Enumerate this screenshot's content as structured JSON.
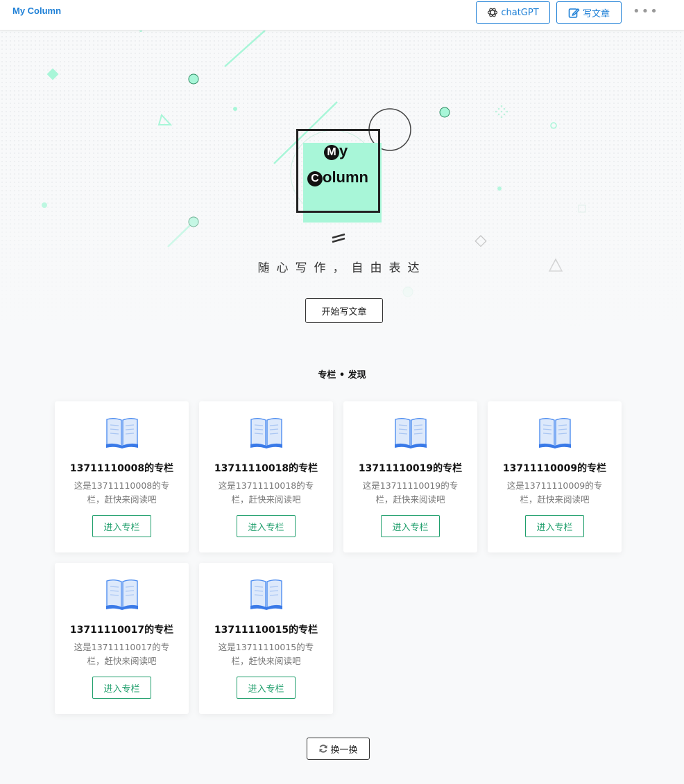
{
  "header": {
    "logo": "My Column",
    "chat_label": "chatGPT",
    "write_label": "写文章",
    "more_label": "•••"
  },
  "hero": {
    "brand_line1": "y",
    "brand_line1_cap": "M",
    "brand_line2": "olumn",
    "brand_line2_cap": "C",
    "slogan": "随心写作，自由表达",
    "start_button": "开始写文章"
  },
  "columns": {
    "title": "专栏 • 发现",
    "items": [
      {
        "title": "13711110008的专栏",
        "desc": "这是13711110008的专栏，赶快来阅读吧",
        "button": "进入专栏"
      },
      {
        "title": "13711110018的专栏",
        "desc": "这是13711110018的专栏，赶快来阅读吧",
        "button": "进入专栏"
      },
      {
        "title": "13711110019的专栏",
        "desc": "这是13711110019的专栏，赶快来阅读吧",
        "button": "进入专栏"
      },
      {
        "title": "13711110009的专栏",
        "desc": "这是13711110009的专栏，赶快来阅读吧",
        "button": "进入专栏"
      },
      {
        "title": "13711110017的专栏",
        "desc": "这是13711110017的专栏，赶快来阅读吧",
        "button": "进入专栏"
      },
      {
        "title": "13711110015的专栏",
        "desc": "这是13711110015的专栏，赶快来阅读吧",
        "button": "进入专栏"
      }
    ],
    "refresh_label": "换一换"
  },
  "colors": {
    "brand_blue": "#1d7fd6",
    "accent_green": "#1e9e6b",
    "mint": "#a8f6d8"
  },
  "icons": {
    "chat": "openai-icon",
    "write": "edit-icon",
    "book": "book-icon",
    "refresh": "refresh-icon"
  }
}
